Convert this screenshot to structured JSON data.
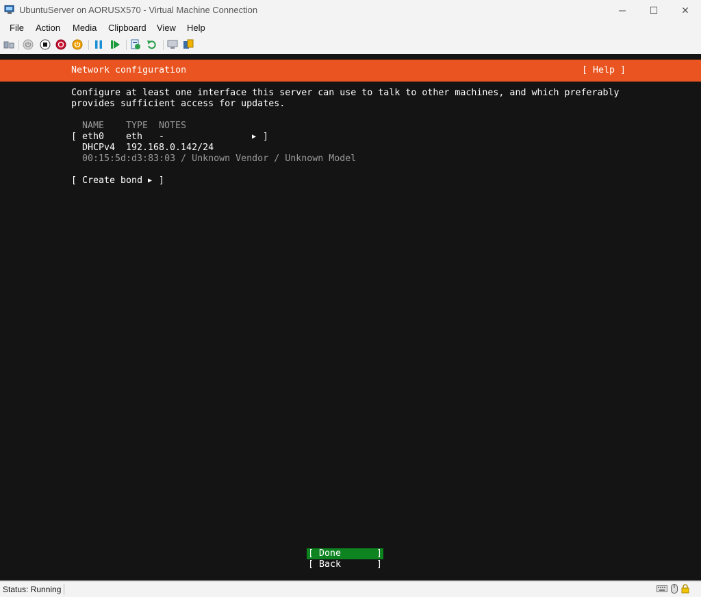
{
  "window": {
    "title": "UbuntuServer on AORUSX570 - Virtual Machine Connection",
    "controls": {
      "minimize": "─",
      "maximize": "☐",
      "close": "✕"
    }
  },
  "menu": [
    "File",
    "Action",
    "Media",
    "Clipboard",
    "View",
    "Help"
  ],
  "toolbar_icons": [
    "ctrl-alt-del-icon",
    "start-icon",
    "turn-off-icon",
    "shut-down-icon",
    "save-icon",
    "pause-icon",
    "reset-icon",
    "checkpoint-icon",
    "revert-icon",
    "enhanced-session-icon",
    "share-icon"
  ],
  "screen": {
    "header": {
      "title": "Network configuration",
      "help": "[ Help ]"
    },
    "intro": [
      "Configure at least one interface this server can use to talk to other machines, and which preferably",
      "provides sufficient access for updates."
    ],
    "table": {
      "columns": {
        "name": "NAME",
        "type": "TYPE",
        "notes": "NOTES"
      },
      "interface": {
        "open": "[",
        "name": "eth0",
        "type": "eth",
        "notes": "-",
        "arrow": "▶",
        "close": "]",
        "dhcp_label": "DHCPv4",
        "address": "192.168.0.142/24",
        "hardware": "00:15:5d:d3:83:03 / Unknown Vendor / Unknown Model"
      }
    },
    "create_bond": {
      "open": "[ Create bond",
      "arrow": "▶",
      "close": "]"
    },
    "buttons": {
      "done": {
        "label": "[ Done",
        "close": "]"
      },
      "back": {
        "label": "[ Back",
        "close": "]"
      }
    }
  },
  "status": {
    "text": "Status: Running"
  },
  "colors": {
    "ubuntu_orange": "#e95420",
    "selected_green": "#0e8420",
    "terminal_bg": "#141414"
  }
}
